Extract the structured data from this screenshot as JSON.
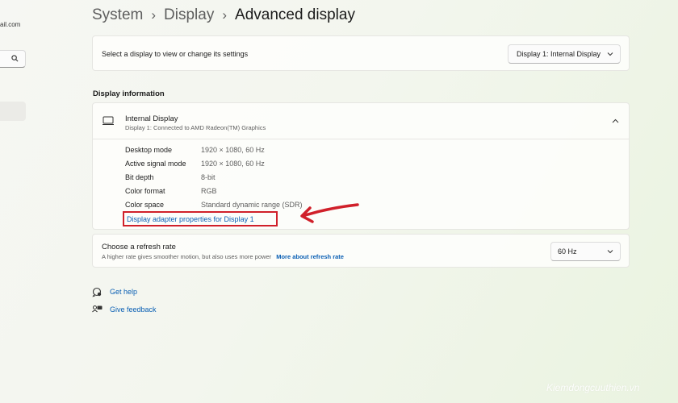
{
  "sidebar": {
    "email_fragment": "ail.com"
  },
  "breadcrumb": {
    "items": [
      "System",
      "Display",
      "Advanced display"
    ],
    "separator": "›"
  },
  "display_select": {
    "prompt": "Select a display to view or change its settings",
    "selected": "Display 1: Internal Display"
  },
  "display_info": {
    "section_title": "Display information",
    "display_name": "Internal Display",
    "display_subtitle": "Display 1: Connected to AMD Radeon(TM) Graphics",
    "rows": [
      {
        "label": "Desktop mode",
        "value": "1920 × 1080, 60 Hz"
      },
      {
        "label": "Active signal mode",
        "value": "1920 × 1080, 60 Hz"
      },
      {
        "label": "Bit depth",
        "value": "8-bit"
      },
      {
        "label": "Color format",
        "value": "RGB"
      },
      {
        "label": "Color space",
        "value": "Standard dynamic range (SDR)"
      }
    ],
    "adapter_link": "Display adapter properties for Display 1"
  },
  "refresh_rate": {
    "title": "Choose a refresh rate",
    "description": "A higher rate gives smoother motion, but also uses more power",
    "link": "More about refresh rate",
    "selected": "60 Hz"
  },
  "help": {
    "get_help": "Get help",
    "give_feedback": "Give feedback"
  },
  "watermark": "Kiemdongcuuthien.vn",
  "colors": {
    "accent_link": "#0a5fb4",
    "annotation_red": "#d0202a"
  }
}
